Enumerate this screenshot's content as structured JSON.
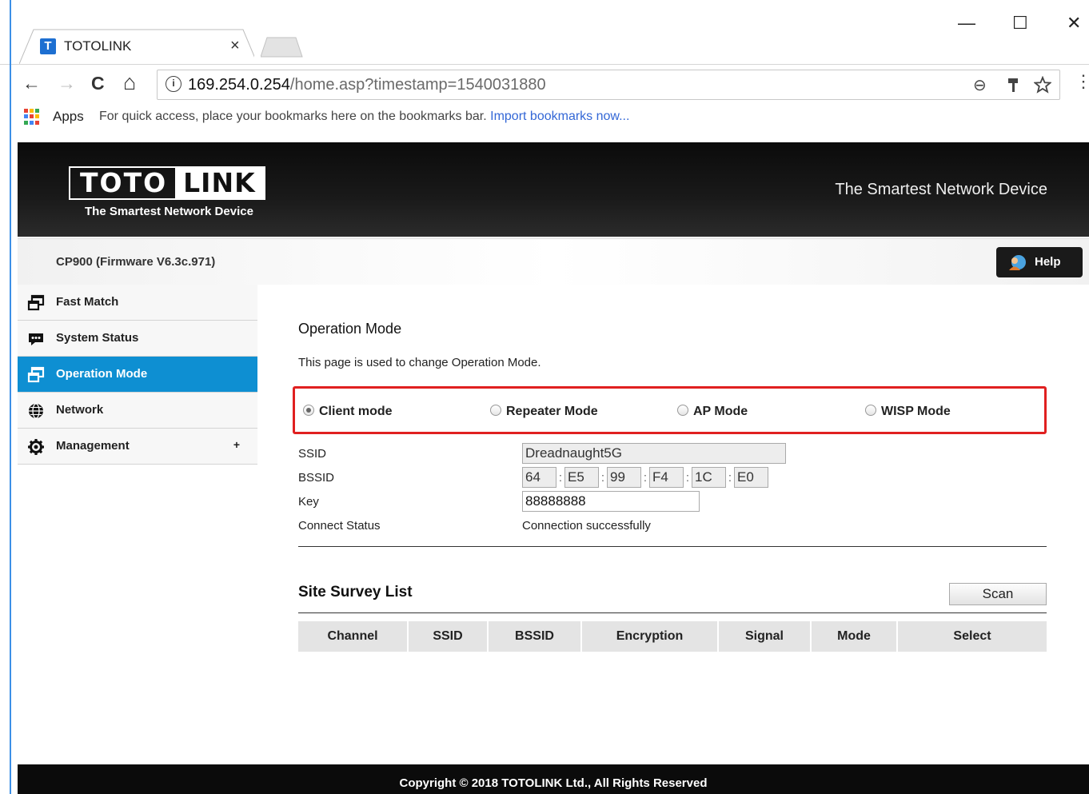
{
  "browser": {
    "tab_title": "TOTOLINK",
    "tab_favicon": "T",
    "url_host": "169.254.0.254",
    "url_path": "/home.asp?timestamp=1540031880",
    "apps_label": "Apps",
    "bookmarks_hint": "For quick access, place your bookmarks here on the bookmarks bar.",
    "bookmarks_link": "Import bookmarks now...",
    "icons": {
      "back": "←",
      "forward": "→",
      "reload": "C",
      "home": "⌂",
      "zoom": "⊖",
      "menu": "⋮",
      "close_tab": "×",
      "minimize": "—",
      "maximize": "☐",
      "close_window": "✕"
    },
    "colors": {
      "active_tab_edge": "#3c8fe6",
      "link": "#3367d6"
    }
  },
  "header": {
    "logo_left": "TOTO",
    "logo_right": "LINK",
    "logo_sub": "The Smartest Network Device",
    "slogan": "The Smartest Network Device",
    "firmware": "CP900 (Firmware V6.3c.971)",
    "help_label": "Help"
  },
  "sidebar": {
    "items": [
      {
        "label": "Fast Match",
        "icon": "window-icon"
      },
      {
        "label": "System Status",
        "icon": "chat-icon"
      },
      {
        "label": "Operation Mode",
        "icon": "window-icon",
        "active": true
      },
      {
        "label": "Network",
        "icon": "globe-icon"
      },
      {
        "label": "Management",
        "icon": "gear-icon",
        "expand": "+"
      }
    ],
    "active_color": "#0e8fd2"
  },
  "main": {
    "title": "Operation Mode",
    "description": "This page is used to change Operation Mode.",
    "modes": [
      {
        "label": "Client mode",
        "selected": true
      },
      {
        "label": "Repeater Mode",
        "selected": false
      },
      {
        "label": "AP Mode",
        "selected": false
      },
      {
        "label": "WISP Mode",
        "selected": false
      }
    ],
    "highlight_color": "#e02020",
    "fields": {
      "ssid_label": "SSID",
      "ssid_value": "Dreadnaught5G",
      "bssid_label": "BSSID",
      "bssid": [
        "64",
        "E5",
        "99",
        "F4",
        "1C",
        "E0"
      ],
      "bssid_separator": ":",
      "key_label": "Key",
      "key_value": "88888888",
      "status_label": "Connect Status",
      "status_value": "Connection successfully"
    },
    "survey": {
      "title": "Site Survey List",
      "scan_label": "Scan",
      "columns": [
        "Channel",
        "SSID",
        "BSSID",
        "Encryption",
        "Signal",
        "Mode",
        "Select"
      ]
    }
  },
  "footer": {
    "copyright": "Copyright © 2018 TOTOLINK Ltd., All Rights Reserved"
  }
}
